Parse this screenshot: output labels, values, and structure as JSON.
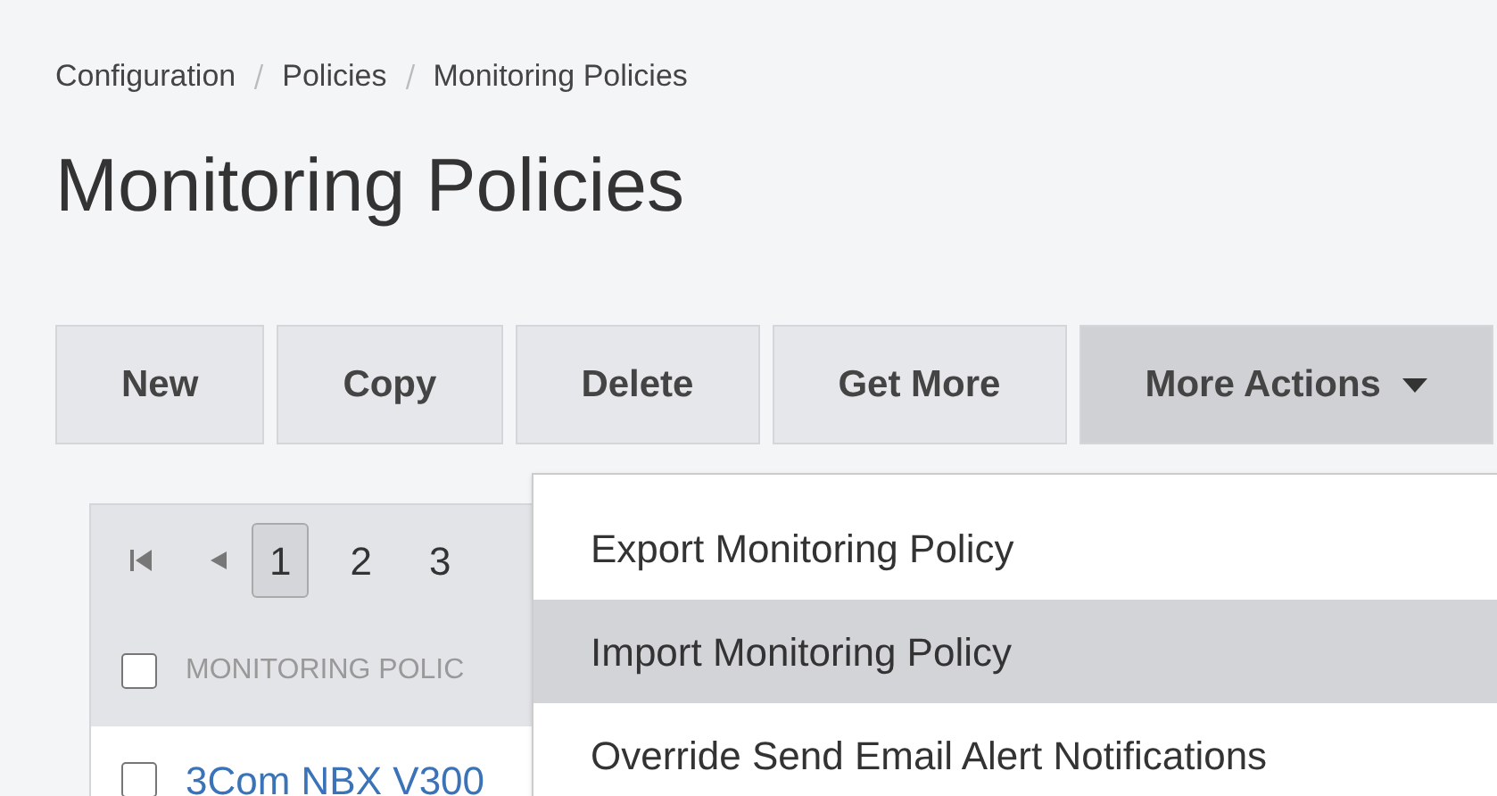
{
  "breadcrumb": [
    "Configuration",
    "Policies",
    "Monitoring Policies"
  ],
  "title": "Monitoring Policies",
  "toolbar": [
    {
      "label": "New",
      "kind": "plain",
      "active": false
    },
    {
      "label": "Copy",
      "kind": "plain",
      "active": false
    },
    {
      "label": "Delete",
      "kind": "plain",
      "active": false
    },
    {
      "label": "Get More",
      "kind": "plain",
      "active": false
    },
    {
      "label": "More Actions",
      "kind": "dropdown",
      "active": true
    }
  ],
  "menu": [
    {
      "label": "Export Monitoring Policy",
      "selected": false
    },
    {
      "label": "Import Monitoring Policy",
      "selected": true
    },
    {
      "label": "Override Send Email Alert Notifications",
      "selected": false
    }
  ],
  "pager": {
    "pages": [
      {
        "label": "1",
        "selected": true
      },
      {
        "label": "2",
        "selected": false
      },
      {
        "label": "3",
        "selected": false
      }
    ]
  },
  "table": {
    "select_all": {
      "checked": false
    },
    "columns": [
      "MONITORING POLIC"
    ],
    "rows": [
      {
        "name": "3Com NBX V300",
        "checked": false
      }
    ]
  }
}
